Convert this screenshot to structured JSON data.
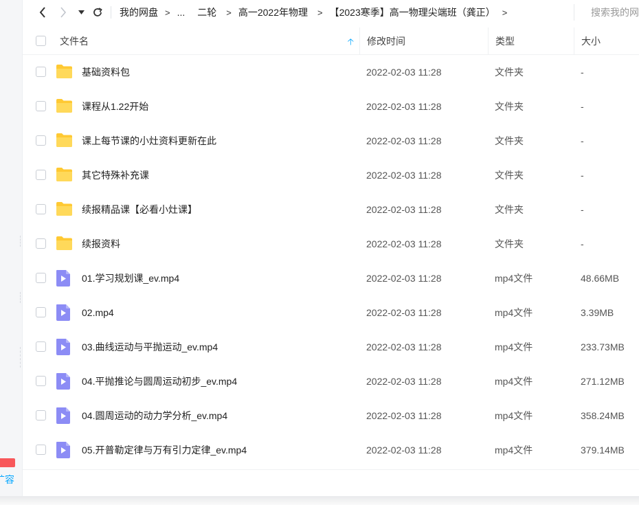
{
  "toolbar": {
    "breadcrumb": [
      "我的网盘",
      "...",
      "二轮",
      "高一2022年物理",
      "【2023寒季】高一物理尖端班（龚正）"
    ],
    "search_placeholder": "搜索我的网盘文件"
  },
  "sidebar": {
    "partial_text": "扩容"
  },
  "columns": {
    "name": "文件名",
    "date": "修改时间",
    "type": "类型",
    "size": "大小"
  },
  "files": [
    {
      "name": "基础资料包",
      "date": "2022-02-03 11:28",
      "type": "文件夹",
      "size": "-",
      "icon": "folder-icon"
    },
    {
      "name": "课程从1.22开始",
      "date": "2022-02-03 11:28",
      "type": "文件夹",
      "size": "-",
      "icon": "folder-icon"
    },
    {
      "name": "课上每节课的小灶资料更新在此",
      "date": "2022-02-03 11:28",
      "type": "文件夹",
      "size": "-",
      "icon": "folder-icon"
    },
    {
      "name": "其它特殊补充课",
      "date": "2022-02-03 11:28",
      "type": "文件夹",
      "size": "-",
      "icon": "folder-icon"
    },
    {
      "name": "续报精品课【必看小灶课】",
      "date": "2022-02-03 11:28",
      "type": "文件夹",
      "size": "-",
      "icon": "folder-icon"
    },
    {
      "name": "续报资料",
      "date": "2022-02-03 11:28",
      "type": "文件夹",
      "size": "-",
      "icon": "folder-icon"
    },
    {
      "name": "01.学习规划课_ev.mp4",
      "date": "2022-02-03 11:28",
      "type": "mp4文件",
      "size": "48.66MB",
      "icon": "video-file-icon"
    },
    {
      "name": "02.mp4",
      "date": "2022-02-03 11:28",
      "type": "mp4文件",
      "size": "3.39MB",
      "icon": "video-file-icon"
    },
    {
      "name": "03.曲线运动与平抛运动_ev.mp4",
      "date": "2022-02-03 11:28",
      "type": "mp4文件",
      "size": "233.73MB",
      "icon": "video-file-icon"
    },
    {
      "name": "04.平抛推论与圆周运动初步_ev.mp4",
      "date": "2022-02-03 11:28",
      "type": "mp4文件",
      "size": "271.12MB",
      "icon": "video-file-icon"
    },
    {
      "name": "04.圆周运动的动力学分析_ev.mp4",
      "date": "2022-02-03 11:28",
      "type": "mp4文件",
      "size": "358.24MB",
      "icon": "video-file-icon"
    },
    {
      "name": "05.开普勒定律与万有引力定律_ev.mp4",
      "date": "2022-02-03 11:28",
      "type": "mp4文件",
      "size": "379.14MB",
      "icon": "video-file-icon"
    }
  ],
  "colors": {
    "accent": "#06a7ff",
    "folder": "#ffd24d",
    "video": "#8c8cf5"
  }
}
